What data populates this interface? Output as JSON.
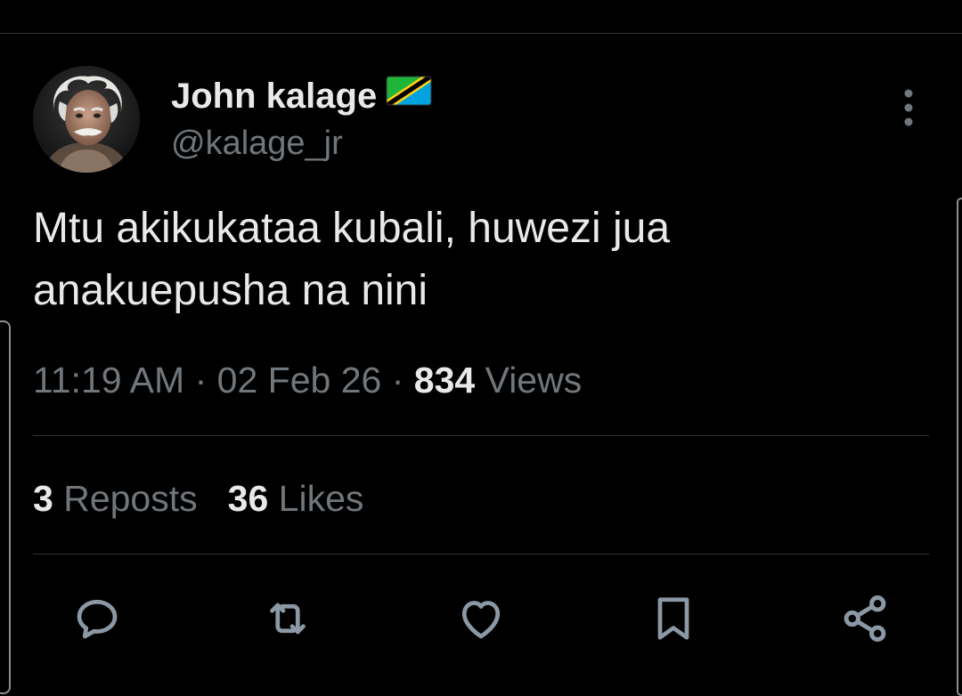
{
  "author": {
    "display_name": "John kalage",
    "handle": "@kalage_jr",
    "flag_icon": "tanzania-flag-icon"
  },
  "tweet": {
    "text": "Mtu akikukataa kubali, huwezi jua anakuepusha na nini",
    "time": "11:19 AM",
    "date": "02 Feb 26",
    "views_count": "834",
    "views_label": "Views",
    "separator": "·"
  },
  "stats": {
    "reposts_count": "3",
    "reposts_label": "Reposts",
    "likes_count": "36",
    "likes_label": "Likes"
  },
  "actions": [
    "reply-icon",
    "repost-icon",
    "like-icon",
    "bookmark-icon",
    "share-icon"
  ],
  "colors": {
    "background": "#000000",
    "primary_text": "#e7e9ea",
    "secondary_text": "#71767b",
    "divider": "#2f3336",
    "icon": "#8b98a5"
  }
}
